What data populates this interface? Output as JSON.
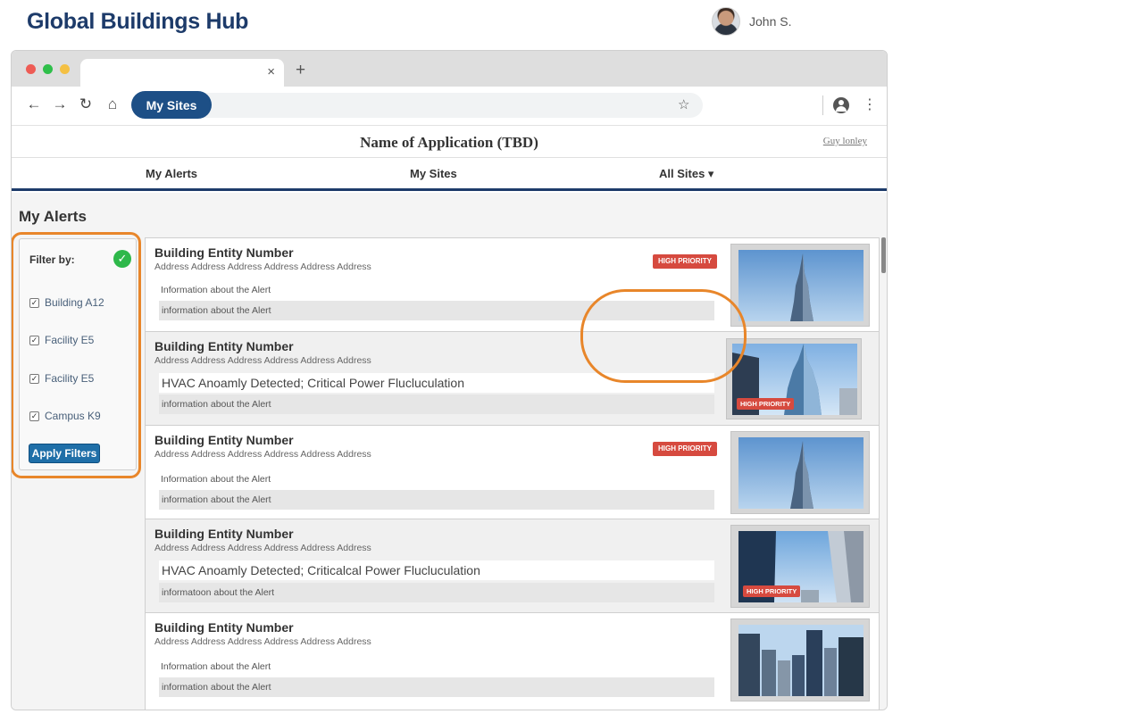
{
  "brand": {
    "title": "Global Buildings Hub"
  },
  "user": {
    "name": "John S."
  },
  "browser": {
    "tab_close": "×",
    "new_tab": "+",
    "back": "←",
    "forward": "→",
    "reload": "↻",
    "home": "⌂",
    "pill_label": "My Sites",
    "star": "☆",
    "menu": "⋮"
  },
  "app": {
    "title": "Name of Application (TBD)",
    "user_link": "Guy lonley",
    "nav": {
      "alerts": "My Alerts",
      "sites": "My Sites",
      "all_sites": "All Sites ▾"
    }
  },
  "page": {
    "title": "My Alerts"
  },
  "filter": {
    "title": "Filter by:",
    "ok_mark": "✓",
    "items": [
      {
        "label": "Building A12",
        "check": "✓"
      },
      {
        "label": "Facility E5",
        "check": "✓"
      },
      {
        "label": "Facility E5",
        "check": "✓"
      },
      {
        "label": "Campus K9",
        "check": "✓"
      }
    ],
    "apply_label": "Apply Filters"
  },
  "alerts": [
    {
      "title": "Building Entity Number",
      "address": "Address Address Address Address Address Address",
      "headline": "",
      "info_1": "Information about the Alert",
      "info_2": "information about the Alert",
      "badge": "HIGH PRIORITY",
      "image": "skyscraper-spire"
    },
    {
      "title": "Building Entity Number",
      "address": "Address Address Address Address Address Address",
      "headline": "HVAC Anoamly Detected; Critical Power Flucluculation",
      "info_1": "",
      "info_2": "information about the Alert",
      "badge": "HIGH PRIORITY",
      "image": "glass-tower"
    },
    {
      "title": "Building Entity Number",
      "address": "Address Address Address Address Address Address",
      "headline": "",
      "info_1": "Information about the Alert",
      "info_2": "information about the Alert",
      "badge": "HIGH PRIORITY",
      "image": "skyscraper-spire"
    },
    {
      "title": "Building Entity Number",
      "address": "Address Address Address Address Address Address",
      "headline": "HVAC Anoamly Detected; Criticalcal Power Flucluculation",
      "info_1": "",
      "info_2": "informatoon about the Alert",
      "badge": "HIGH PRIORITY",
      "image": "office-towers"
    },
    {
      "title": "Building Entity Number",
      "address": "Address Address Address Address Address Address",
      "headline": "",
      "info_1": "Information about the Alert",
      "info_2": "information about the Alert",
      "badge": "",
      "image": "city-skyline"
    }
  ],
  "colors": {
    "brand": "#1d3b6a",
    "accent": "#1d4f86",
    "highlight_outline": "#e8862a",
    "priority_badge": "#d64a3f",
    "success": "#2eb84a"
  }
}
